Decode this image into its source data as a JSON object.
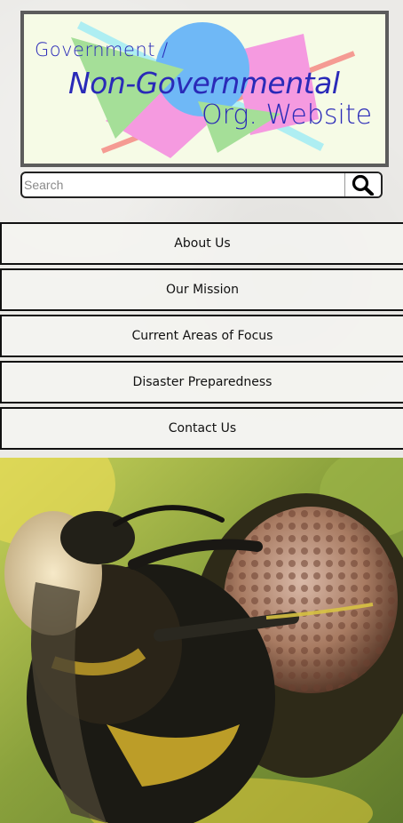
{
  "header": {
    "title_line1": "Government /",
    "title_line2": "Non-Governmental",
    "title_line3": "Org. Website"
  },
  "search": {
    "placeholder": "Search",
    "value": "",
    "button_icon": "search-icon"
  },
  "nav": {
    "items": [
      {
        "label": "About Us"
      },
      {
        "label": "Our Mission"
      },
      {
        "label": "Current Areas of Focus"
      },
      {
        "label": "Disaster Preparedness"
      },
      {
        "label": "Contact Us"
      }
    ]
  },
  "hero": {
    "subject": "bee-on-flower-photo"
  },
  "colors": {
    "title_blue": "#2a2ab8",
    "banner_bg": "#f6fbe6",
    "shape_green": "#a5df98",
    "shape_pink": "#f59ae0",
    "shape_blue": "#6fb8f6",
    "shape_cyan": "#aeeef2",
    "shape_salmon": "#f59b93"
  }
}
